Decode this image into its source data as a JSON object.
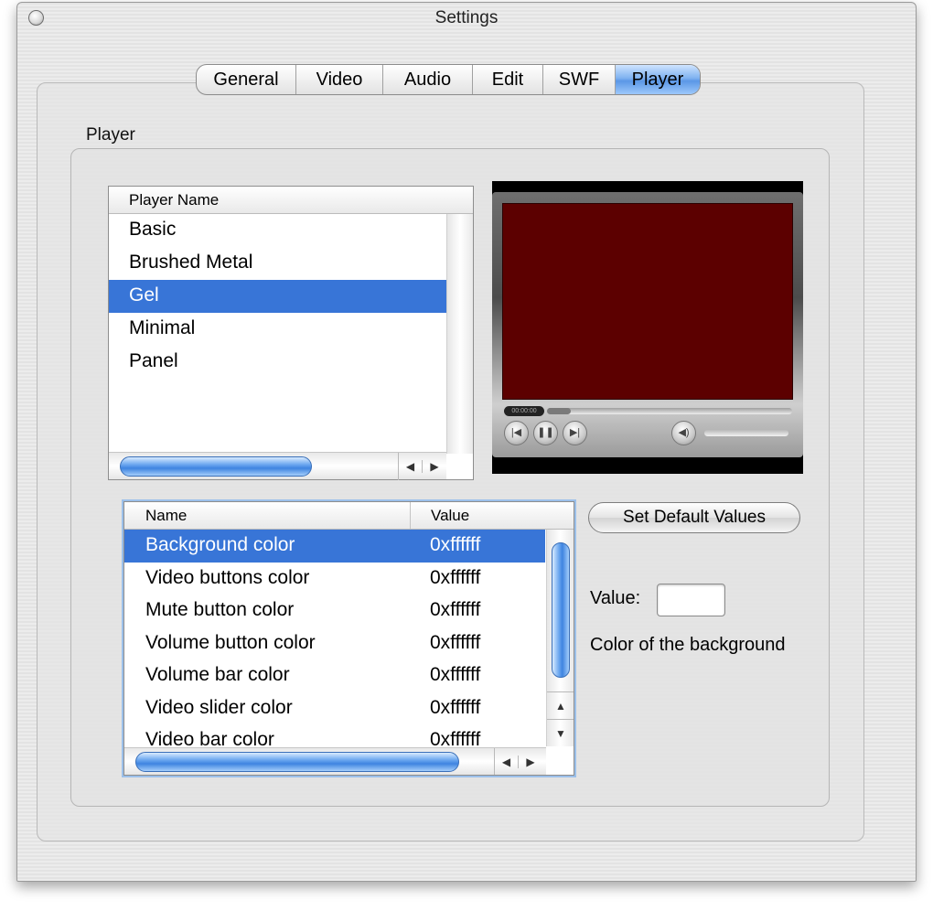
{
  "window": {
    "title": "Settings"
  },
  "tabs": [
    {
      "label": "General"
    },
    {
      "label": "Video"
    },
    {
      "label": "Audio"
    },
    {
      "label": "Edit"
    },
    {
      "label": "SWF"
    },
    {
      "label": "Player",
      "active": true
    }
  ],
  "group": {
    "label": "Player"
  },
  "player_list": {
    "header": "Player Name",
    "items": [
      "Basic",
      "Brushed Metal",
      "Gel",
      "Minimal",
      "Panel"
    ],
    "selected": "Gel"
  },
  "preview": {
    "video_color": "#5c0000",
    "time_readout": "00:00:00",
    "buttons": [
      "rewind-icon",
      "pause-icon",
      "forward-icon",
      "volume-icon"
    ]
  },
  "properties": {
    "columns": [
      "Name",
      "Value"
    ],
    "rows": [
      {
        "name": "Background color",
        "value": "0xffffff"
      },
      {
        "name": "Video buttons color",
        "value": "0xffffff"
      },
      {
        "name": "Mute button color",
        "value": "0xffffff"
      },
      {
        "name": "Volume button color",
        "value": "0xffffff"
      },
      {
        "name": "Volume bar color",
        "value": "0xffffff"
      },
      {
        "name": "Video slider color",
        "value": "0xffffff"
      },
      {
        "name": "Video bar color",
        "value": "0xffffff"
      }
    ],
    "selected": "Background color"
  },
  "set_default_button": "Set Default Values",
  "value_label": "Value:",
  "value_swatch_color": "#ffffff",
  "description": "Color of the background",
  "colors": {
    "accent": "#3875d7",
    "selection_text": "#ffffff"
  }
}
